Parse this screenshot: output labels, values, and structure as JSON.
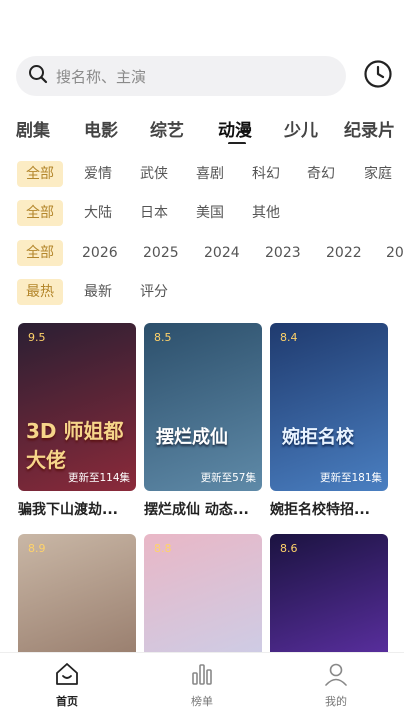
{
  "search": {
    "placeholder": "搜名称、主演"
  },
  "tabs": [
    "剧集",
    "电影",
    "综艺",
    "动漫",
    "少儿",
    "纪录片"
  ],
  "filters": {
    "genre": [
      "全部",
      "爱情",
      "武侠",
      "喜剧",
      "科幻",
      "奇幻",
      "家庭"
    ],
    "region": [
      "全部",
      "大陆",
      "日本",
      "美国",
      "其他"
    ],
    "year": [
      "全部",
      "2026",
      "2025",
      "2024",
      "2023",
      "2022",
      "20"
    ],
    "sort": [
      "最热",
      "最新",
      "评分"
    ]
  },
  "cards": [
    {
      "score": "9.5",
      "update": "更新至114集",
      "title": "骗我下山渡劫...",
      "poster_text": "3D 师姐都大佬",
      "colors": [
        "#2a1f33",
        "#8b2a3a"
      ]
    },
    {
      "score": "8.5",
      "update": "更新至57集",
      "title": "摆烂成仙 动态...",
      "poster_text": "摆烂成仙",
      "colors": [
        "#2c4f6b",
        "#5f8aa8"
      ]
    },
    {
      "score": "8.4",
      "update": "更新至181集",
      "title": "婉拒名校特招...",
      "poster_text": "婉拒名校",
      "colors": [
        "#1f3a6e",
        "#4a7fc1"
      ]
    },
    {
      "score": "8.9",
      "update": "",
      "title": "",
      "poster_text": "",
      "colors": [
        "#c9b7a6",
        "#8c6f5f"
      ]
    },
    {
      "score": "8.8",
      "update": "",
      "title": "",
      "poster_text": "",
      "colors": [
        "#e9b7c6",
        "#c6d2ee"
      ]
    },
    {
      "score": "8.6",
      "update": "",
      "title": "",
      "poster_text": "",
      "colors": [
        "#1b1340",
        "#6a36b8"
      ]
    }
  ],
  "nav": [
    {
      "label": "首页",
      "icon": "home-icon"
    },
    {
      "label": "榜单",
      "icon": "chart-icon"
    },
    {
      "label": "我的",
      "icon": "user-icon"
    }
  ]
}
